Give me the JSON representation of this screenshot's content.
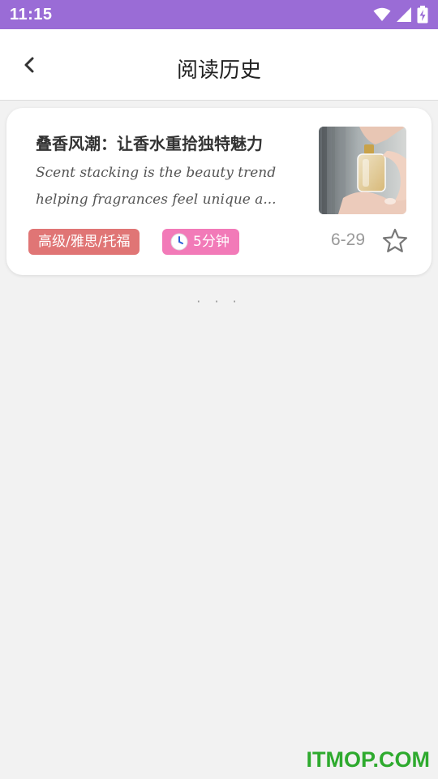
{
  "status_bar": {
    "time": "11:15",
    "bg_color": "#9a6cd6",
    "icons": [
      "wifi-icon",
      "cellular-signal-icon",
      "battery-charging-icon"
    ]
  },
  "header": {
    "back_icon": "chevron-left-icon",
    "title": "阅读历史"
  },
  "history": {
    "items": [
      {
        "title": "叠香风潮：让香水重拾独特魅力",
        "excerpt_line1": "Scent stacking is the beauty trend",
        "excerpt_line2": "helping fragrances feel unique a...",
        "thumbnail": "perfume-spray-photo",
        "level_tag": "高级/雅思/托福",
        "level_tag_color": "#e07575",
        "duration_icon": "clock-icon",
        "duration": "5分钟",
        "duration_tag_color": "#f27ab8",
        "date": "6-29",
        "favorite_icon": "star-outline-icon"
      }
    ],
    "more_indicator": "· · ·"
  },
  "watermark": {
    "text": "ITMOP.COM",
    "color": "#2eaa2e"
  }
}
